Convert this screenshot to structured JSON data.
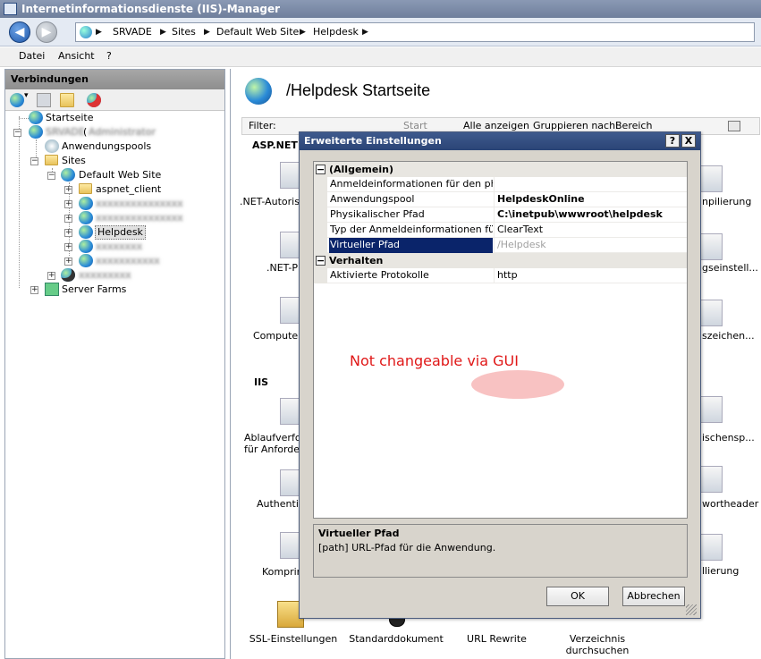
{
  "window": {
    "title": "Internetinformationsdienste (IIS)-Manager"
  },
  "address": {
    "crumbs": [
      "SRVADE",
      "Sites",
      "Default Web Site",
      "Helpdesk"
    ]
  },
  "menu": [
    "Datei",
    "Ansicht",
    "?"
  ],
  "connections": {
    "header": "Verbindungen",
    "tree": {
      "start": "Startseite",
      "server_prefix": "(",
      "app_pools": "Anwendungspools",
      "sites": "Sites",
      "default_site": "Default Web Site",
      "aspnet_client": "aspnet_client",
      "helpdesk": "Helpdesk",
      "server_farms": "Server Farms"
    }
  },
  "main": {
    "title": "/Helpdesk Startseite",
    "filter": {
      "label": "Filter:",
      "start": "Start",
      "show_all": "Alle anzeigen",
      "group_by": "Gruppieren nach:",
      "group_value": "Bereich"
    },
    "sections": {
      "aspnet": "ASP.NET",
      "iis": "IIS"
    },
    "features": [
      {
        "label": ".NET-Autoris"
      },
      {
        "label": ".NET-P"
      },
      {
        "label": "Computers"
      },
      {
        "label": "Ablaufverfolg\nfür Anforder"
      },
      {
        "label": "Authentifi"
      },
      {
        "label": "Komprimi"
      },
      {
        "label": "SSL-Einstellungen"
      },
      {
        "label": "Standarddokument"
      },
      {
        "label": "URL Rewrite"
      },
      {
        "label": "Verzeichnis\ndurchsuchen"
      },
      {
        "label": "npilierung"
      },
      {
        "label": "gseinstell..."
      },
      {
        "label": "szeichen..."
      },
      {
        "label": "ischensp..."
      },
      {
        "label": "wortheader"
      },
      {
        "label": "llierung"
      }
    ]
  },
  "dialog": {
    "title": "Erweiterte Einstellungen",
    "help_button": "?",
    "close_button": "X",
    "groups": [
      {
        "name": "(Allgemein)",
        "toggle": "−",
        "props": [
          {
            "name": "Anmeldeinformationen für den physika",
            "value": ""
          },
          {
            "name": "Anwendungspool",
            "value": "HelpdeskOnline"
          },
          {
            "name": "Physikalischer Pfad",
            "value": "C:\\inetpub\\wwwroot\\helpdesk"
          },
          {
            "name": "Typ der Anmeldeinformationen für der",
            "value": "ClearText"
          },
          {
            "name": "Virtueller Pfad",
            "value": "/Helpdesk"
          }
        ]
      },
      {
        "name": "Verhalten",
        "toggle": "−",
        "props": [
          {
            "name": "Aktivierte Protokolle",
            "value": "http"
          }
        ]
      }
    ],
    "annotation": "Not changeable via GUI",
    "description": {
      "title": "Virtueller Pfad",
      "text": "[path] URL-Pfad für die Anwendung."
    },
    "ok": "OK",
    "cancel": "Abbrechen"
  }
}
